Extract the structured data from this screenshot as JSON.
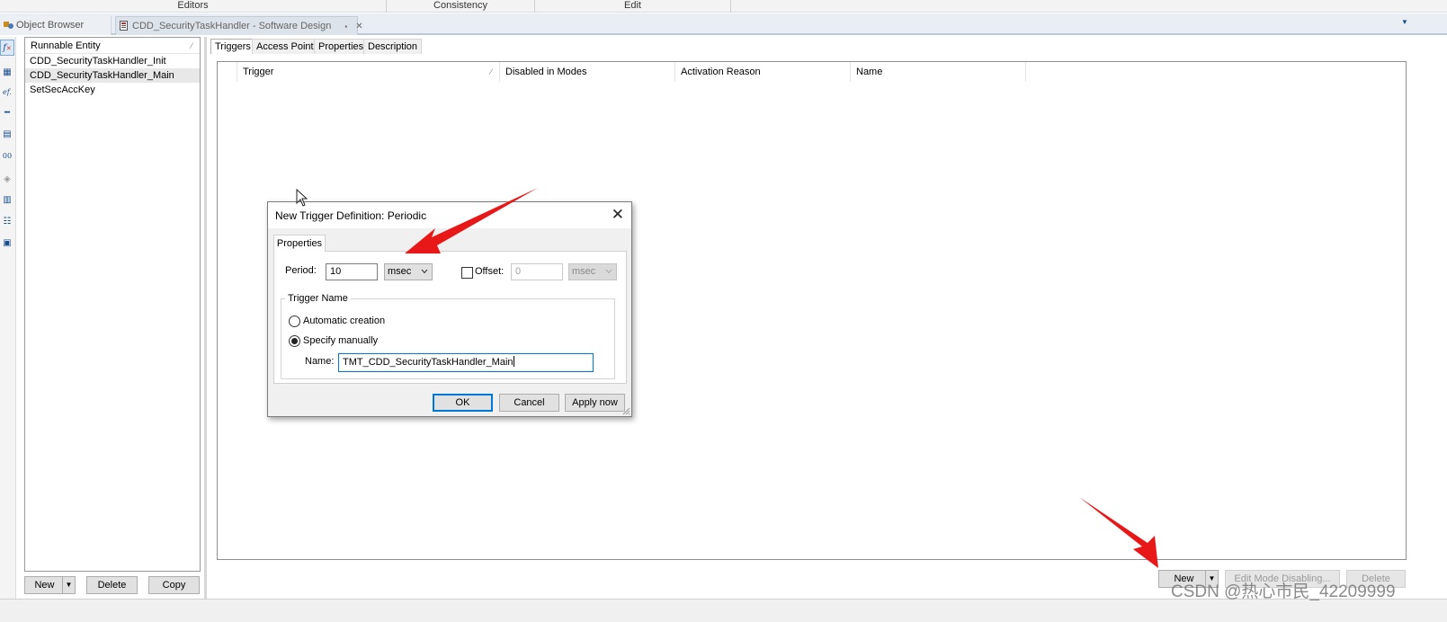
{
  "ribbon": {
    "groups": [
      "Editors",
      "Consistency",
      "Edit"
    ]
  },
  "tabs": [
    {
      "label": "Object Browser"
    },
    {
      "label": "CDD_SecurityTaskHandler - Software Design",
      "pin": "▪",
      "close": "✕"
    }
  ],
  "left_panel": {
    "header": "Runnable Entity",
    "items": [
      "CDD_SecurityTaskHandler_Init",
      "CDD_SecurityTaskHandler_Main",
      "SetSecAccKey"
    ],
    "selected_index": 1,
    "buttons": {
      "new": "New",
      "delete": "Delete",
      "copy": "Copy"
    }
  },
  "editor_tabs": [
    "Triggers",
    "Access Points",
    "Properties",
    "Description"
  ],
  "grid": {
    "columns": [
      "Trigger",
      "Disabled in Modes",
      "Activation Reason",
      "Name"
    ]
  },
  "dialog": {
    "title": "New Trigger Definition: Periodic",
    "tab": "Properties",
    "period_label": "Period:",
    "period_value": "10",
    "period_unit": "msec",
    "offset_label": "Offset:",
    "offset_checked": false,
    "offset_value": "0",
    "offset_unit": "msec",
    "group_label": "Trigger Name",
    "radio_auto": "Automatic creation",
    "radio_manual": "Specify manually",
    "selected_radio": "manual",
    "name_label": "Name:",
    "name_value": "TMT_CDD_SecurityTaskHandler_Main",
    "ok": "OK",
    "cancel": "Cancel",
    "apply": "Apply now"
  },
  "bottom_buttons": {
    "new": "New",
    "edit_mode": "Edit Mode Disabling...",
    "delete": "Delete"
  },
  "watermark": "CSDN @热心市民_42209999",
  "colors": {
    "annotation_arrow": "#e81818",
    "focus_border": "#0078d7"
  }
}
